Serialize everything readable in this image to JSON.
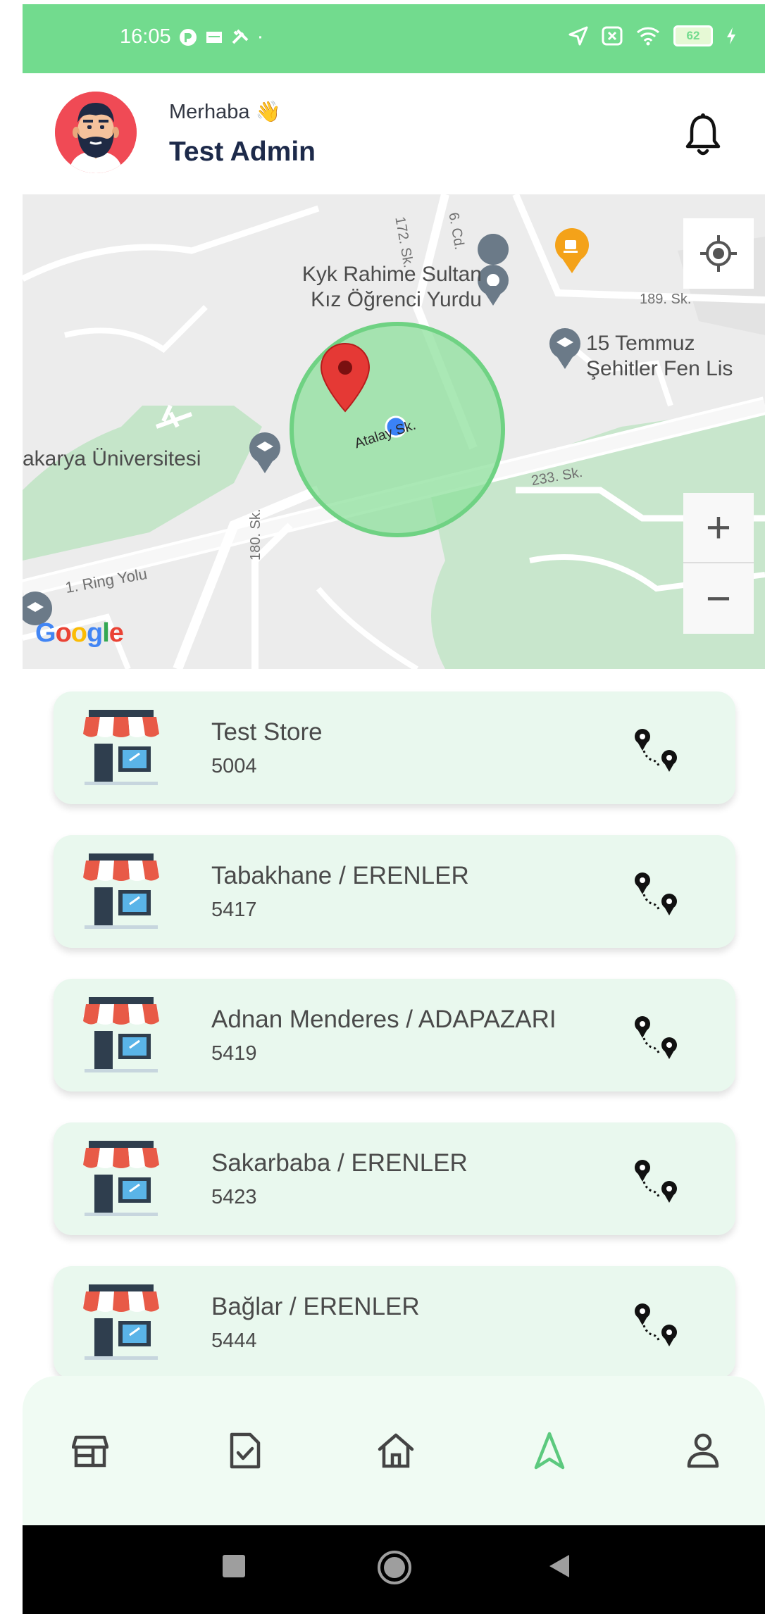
{
  "status_bar": {
    "time": "16:05",
    "battery_level": "62",
    "colors": {
      "background": "#72db8e"
    }
  },
  "header": {
    "greeting": "Merhaba",
    "greeting_emoji": "👋",
    "user_name": "Test Admin",
    "avatar_icon": "bearded-man-avatar",
    "notification_icon": "bell-icon"
  },
  "map": {
    "places": [
      {
        "name": "Kyk Rahime Sultan\nKız Öğrenci Yurdu"
      },
      {
        "name": "15 Temmuz\nŞehitler Fen Lis"
      },
      {
        "name": "akarya Üniversitesi"
      }
    ],
    "roads": [
      "172. Sk.",
      "6. Cd.",
      "189. Sk.",
      "Atalay Sk.",
      "233. Sk.",
      "1. Ring Yolu",
      "180. Sk."
    ],
    "zoom_in_label": "+",
    "zoom_out_label": "−",
    "google_logo": [
      "G",
      "o",
      "o",
      "g",
      "l",
      "e"
    ],
    "colors": {
      "geofence": "#7fdc8f",
      "marker": "#e53935",
      "user_dot": "#3b82f6"
    }
  },
  "stores": [
    {
      "name": "Test Store",
      "code": "5004"
    },
    {
      "name": "Tabakhane / ERENLER",
      "code": "5417"
    },
    {
      "name": "Adnan Menderes / ADAPAZARI",
      "code": "5419"
    },
    {
      "name": "Sakarbaba / ERENLER",
      "code": "5423"
    },
    {
      "name": "Bağlar / ERENLER",
      "code": "5444"
    }
  ],
  "bottom_nav": {
    "items": [
      {
        "icon": "store-icon"
      },
      {
        "icon": "checklist-icon"
      },
      {
        "icon": "home-icon"
      },
      {
        "icon": "navigation-icon",
        "active": true
      },
      {
        "icon": "profile-icon"
      }
    ],
    "colors": {
      "active": "#5cc97e",
      "inactive": "#444444"
    }
  }
}
